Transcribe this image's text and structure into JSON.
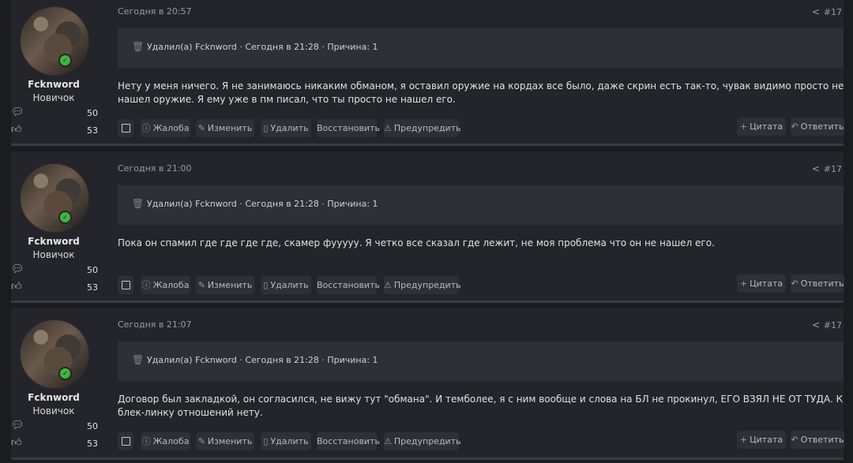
{
  "posts": [
    {
      "username": "Fcknword",
      "user_title": "Новичок",
      "messages": "50",
      "reactions": "53",
      "date": "Сегодня в 20:57",
      "post_number": "#17",
      "deleted_info": "Удалил(а) Fcknword · Сегодня в 21:28 · Причина: 1",
      "text": "Нету у меня ничего. Я не занимаюсь никаким обманом, я оставил оружие на кордах все было, даже скрин есть так-то, чувак видимо просто не нашел оружие. Я ему уже в пм писал, что ты просто не нашел его."
    },
    {
      "username": "Fcknword",
      "user_title": "Новичок",
      "messages": "50",
      "reactions": "53",
      "date": "Сегодня в 21:00",
      "post_number": "#17",
      "deleted_info": "Удалил(а) Fcknword · Сегодня в 21:28 · Причина: 1",
      "text": "Пока он спамил где где где где, скамер фууууу. Я четко все сказал где лежит, не моя проблема что он не нашел его."
    },
    {
      "username": "Fcknword",
      "user_title": "Новичок",
      "messages": "50",
      "reactions": "53",
      "date": "Сегодня в 21:07",
      "post_number": "#17",
      "deleted_info": "Удалил(а) Fcknword · Сегодня в 21:28 · Причина: 1",
      "text": "Договор был закладкой, он согласился, не вижу тут \"обмана\". И темболее, я с ним вообще и слова на БЛ не прокинул, ЕГО ВЗЯЛ НЕ ОТ ТУДА. К блек-линку отношений нету."
    }
  ],
  "actions": {
    "report": "Жалоба",
    "edit": "Изменить",
    "delete": "Удалить",
    "restore": "Восстановить",
    "warn": "Предупредить",
    "quote": "Цитата",
    "reply": "Ответить"
  }
}
